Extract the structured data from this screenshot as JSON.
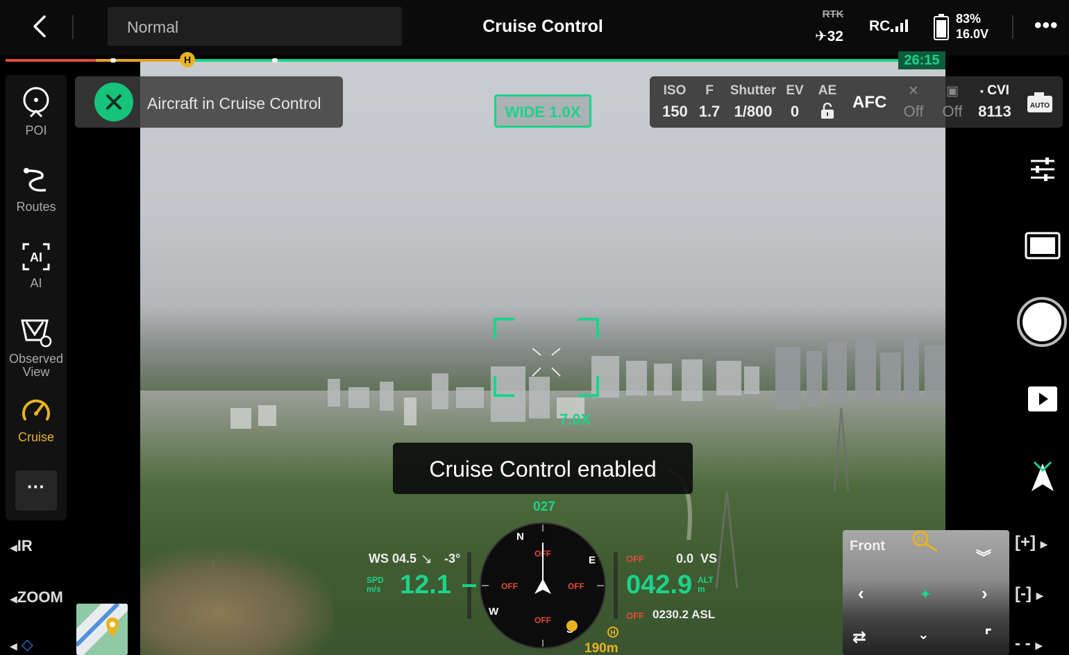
{
  "topbar": {
    "mode_label": "Normal",
    "title": "Cruise Control",
    "rtk_label": "RTK",
    "satellites": "32",
    "rc_label": "RC",
    "battery_percent": "83%",
    "battery_voltage": "16.0V"
  },
  "flight_progress": {
    "timer": "26:15",
    "home_marker": "H"
  },
  "left_nav": {
    "items": [
      {
        "label": "POI",
        "icon": "poi-icon"
      },
      {
        "label": "Routes",
        "icon": "routes-icon"
      },
      {
        "label": "AI",
        "icon": "ai-icon"
      },
      {
        "label": "Observed View",
        "line1": "Observed",
        "line2": "View",
        "icon": "observed-view-icon"
      },
      {
        "label": "Cruise",
        "icon": "cruise-icon",
        "active": true
      }
    ],
    "more_label": "···",
    "ir_label": "IR",
    "zoom_label": "ZOOM"
  },
  "status_banner": {
    "text": "Aircraft in Cruise Control"
  },
  "lens": {
    "label": "WIDE 1.0X"
  },
  "camera_params": {
    "iso_label": "ISO",
    "iso_value": "150",
    "f_label": "F",
    "f_value": "1.7",
    "shutter_label": "Shutter",
    "shutter_value": "1/800",
    "ev_label": "EV",
    "ev_value": "0",
    "ae_label": "AE",
    "focus_mode": "AFC",
    "flash_value": "Off",
    "record_value": "Off",
    "storage_label": "CVI",
    "storage_value": "8113"
  },
  "viewfinder": {
    "zoom_text": "7.0X"
  },
  "toast": {
    "message": "Cruise Control enabled"
  },
  "telemetry": {
    "heading": "027",
    "wind_speed": "WS 04.5",
    "pitch": "-3°",
    "spd_label_1": "SPD",
    "spd_label_2": "m/s",
    "speed": "12.1",
    "altitude": "042.9",
    "alt_label_1": "ALT",
    "alt_label_2": "m",
    "vs_value": "0.0",
    "vs_label": "VS",
    "asl": "0230.2 ASL",
    "home_distance": "190m",
    "off_label": "OFF",
    "compass_n": "N",
    "compass_e": "E",
    "compass_s": "S",
    "compass_w": "W"
  },
  "pip": {
    "label": "Front"
  },
  "camera_controls": {
    "zoom_in": "[+]",
    "zoom_out": "[-]"
  },
  "colors": {
    "accent_green": "#1bd38a",
    "accent_yellow": "#e9b320",
    "warning_red": "#e04a3a"
  }
}
